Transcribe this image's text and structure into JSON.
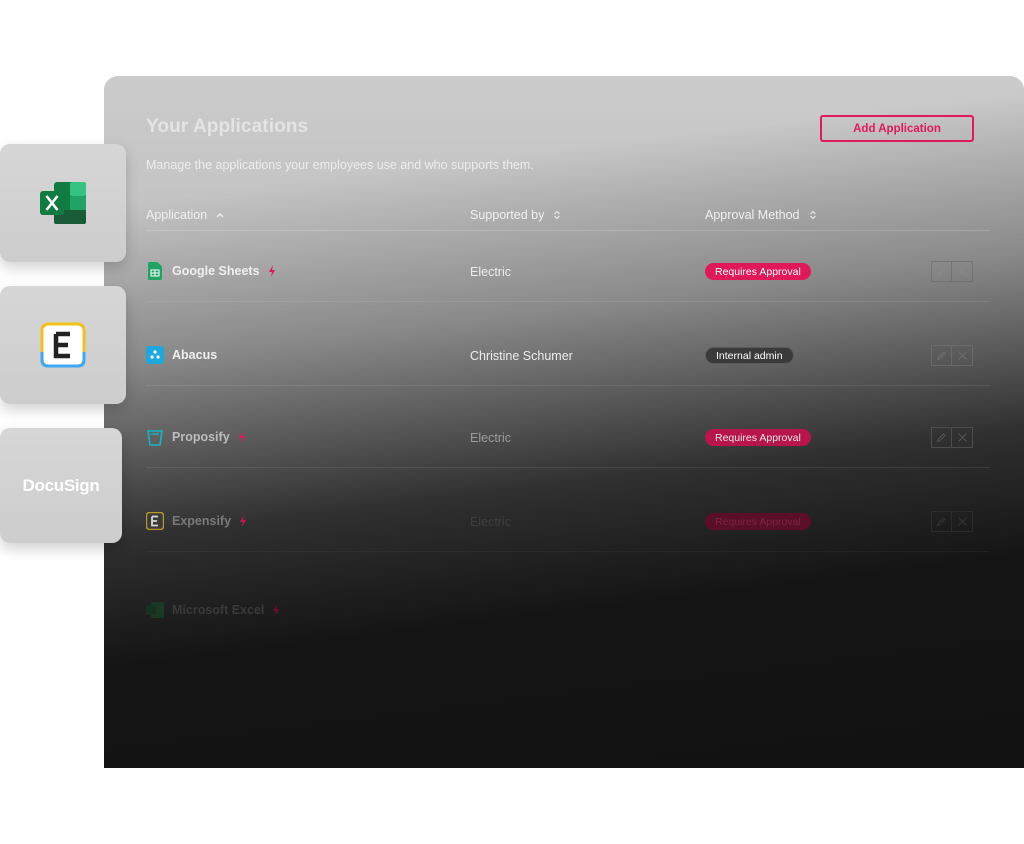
{
  "header": {
    "title": "Your Applications",
    "subtitle": "Manage the applications your employees use and who supports them.",
    "add_button": "Add Application"
  },
  "table": {
    "columns": [
      "Application",
      "Supported by",
      "Approval Method"
    ],
    "rows": [
      {
        "name": "Google Sheets",
        "supported_by": "Electric",
        "approval": "Requires Approval",
        "badge_color": "#e0195a",
        "icon": "google-sheets-icon"
      },
      {
        "name": "Abacus",
        "supported_by": "Christine Schumer",
        "approval": "Internal admin",
        "badge_color": "#3a3a3a",
        "icon": "abacus-icon"
      },
      {
        "name": "Proposify",
        "supported_by": "Electric",
        "approval": "Requires Approval",
        "badge_color": "#e0195a",
        "icon": "proposify-icon"
      },
      {
        "name": "Expensify",
        "supported_by": "Electric",
        "approval": "Requires Approval",
        "badge_color": "#e0195a",
        "icon": "expensify-icon"
      },
      {
        "name": "Microsoft Excel",
        "supported_by": "",
        "approval": "",
        "badge_color": "#e0195a",
        "icon": "microsoft-excel-icon"
      }
    ]
  },
  "side_apps": {
    "docusign_label": "DocuSign"
  },
  "colors": {
    "accent": "#e0195a",
    "text_light": "#f0f0f0"
  }
}
